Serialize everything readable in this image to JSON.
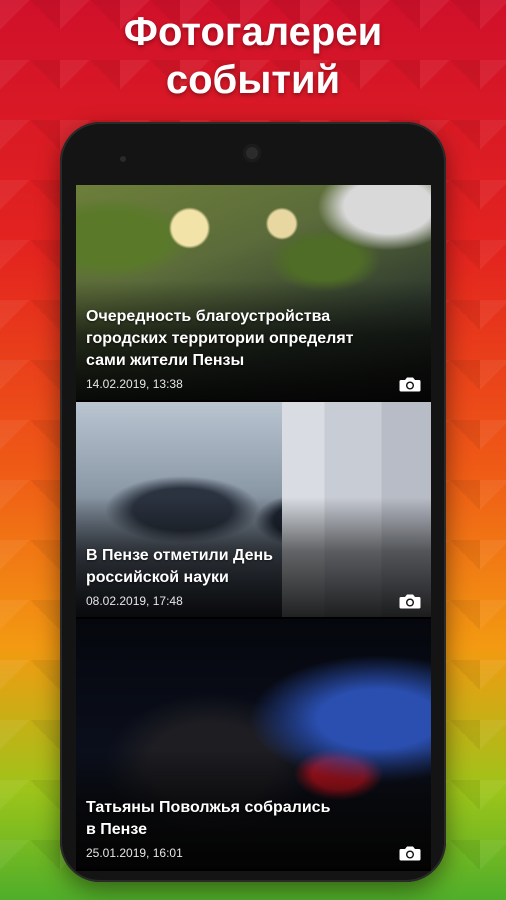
{
  "promo": {
    "title_line1": "Фотогалереи",
    "title_line2": "событий"
  },
  "gallery": {
    "items": [
      {
        "title_lines": [
          "Очередность благоустройства",
          "городских территории определят",
          "сами жители Пензы"
        ],
        "date": "14.02.2019, 13:38",
        "icon": "camera-icon"
      },
      {
        "title_lines": [
          "В Пензе отметили День",
          "российской науки"
        ],
        "date": "08.02.2019, 17:48",
        "icon": "camera-icon"
      },
      {
        "title_lines": [
          "Татьяны Поволжья собрались",
          "в Пензе"
        ],
        "date": "25.01.2019, 16:01",
        "icon": "camera-icon"
      }
    ]
  },
  "colors": {
    "background_top": "#d0102a",
    "background_bottom": "#4fae2a",
    "phone_body": "#141414",
    "text": "#ffffff"
  }
}
